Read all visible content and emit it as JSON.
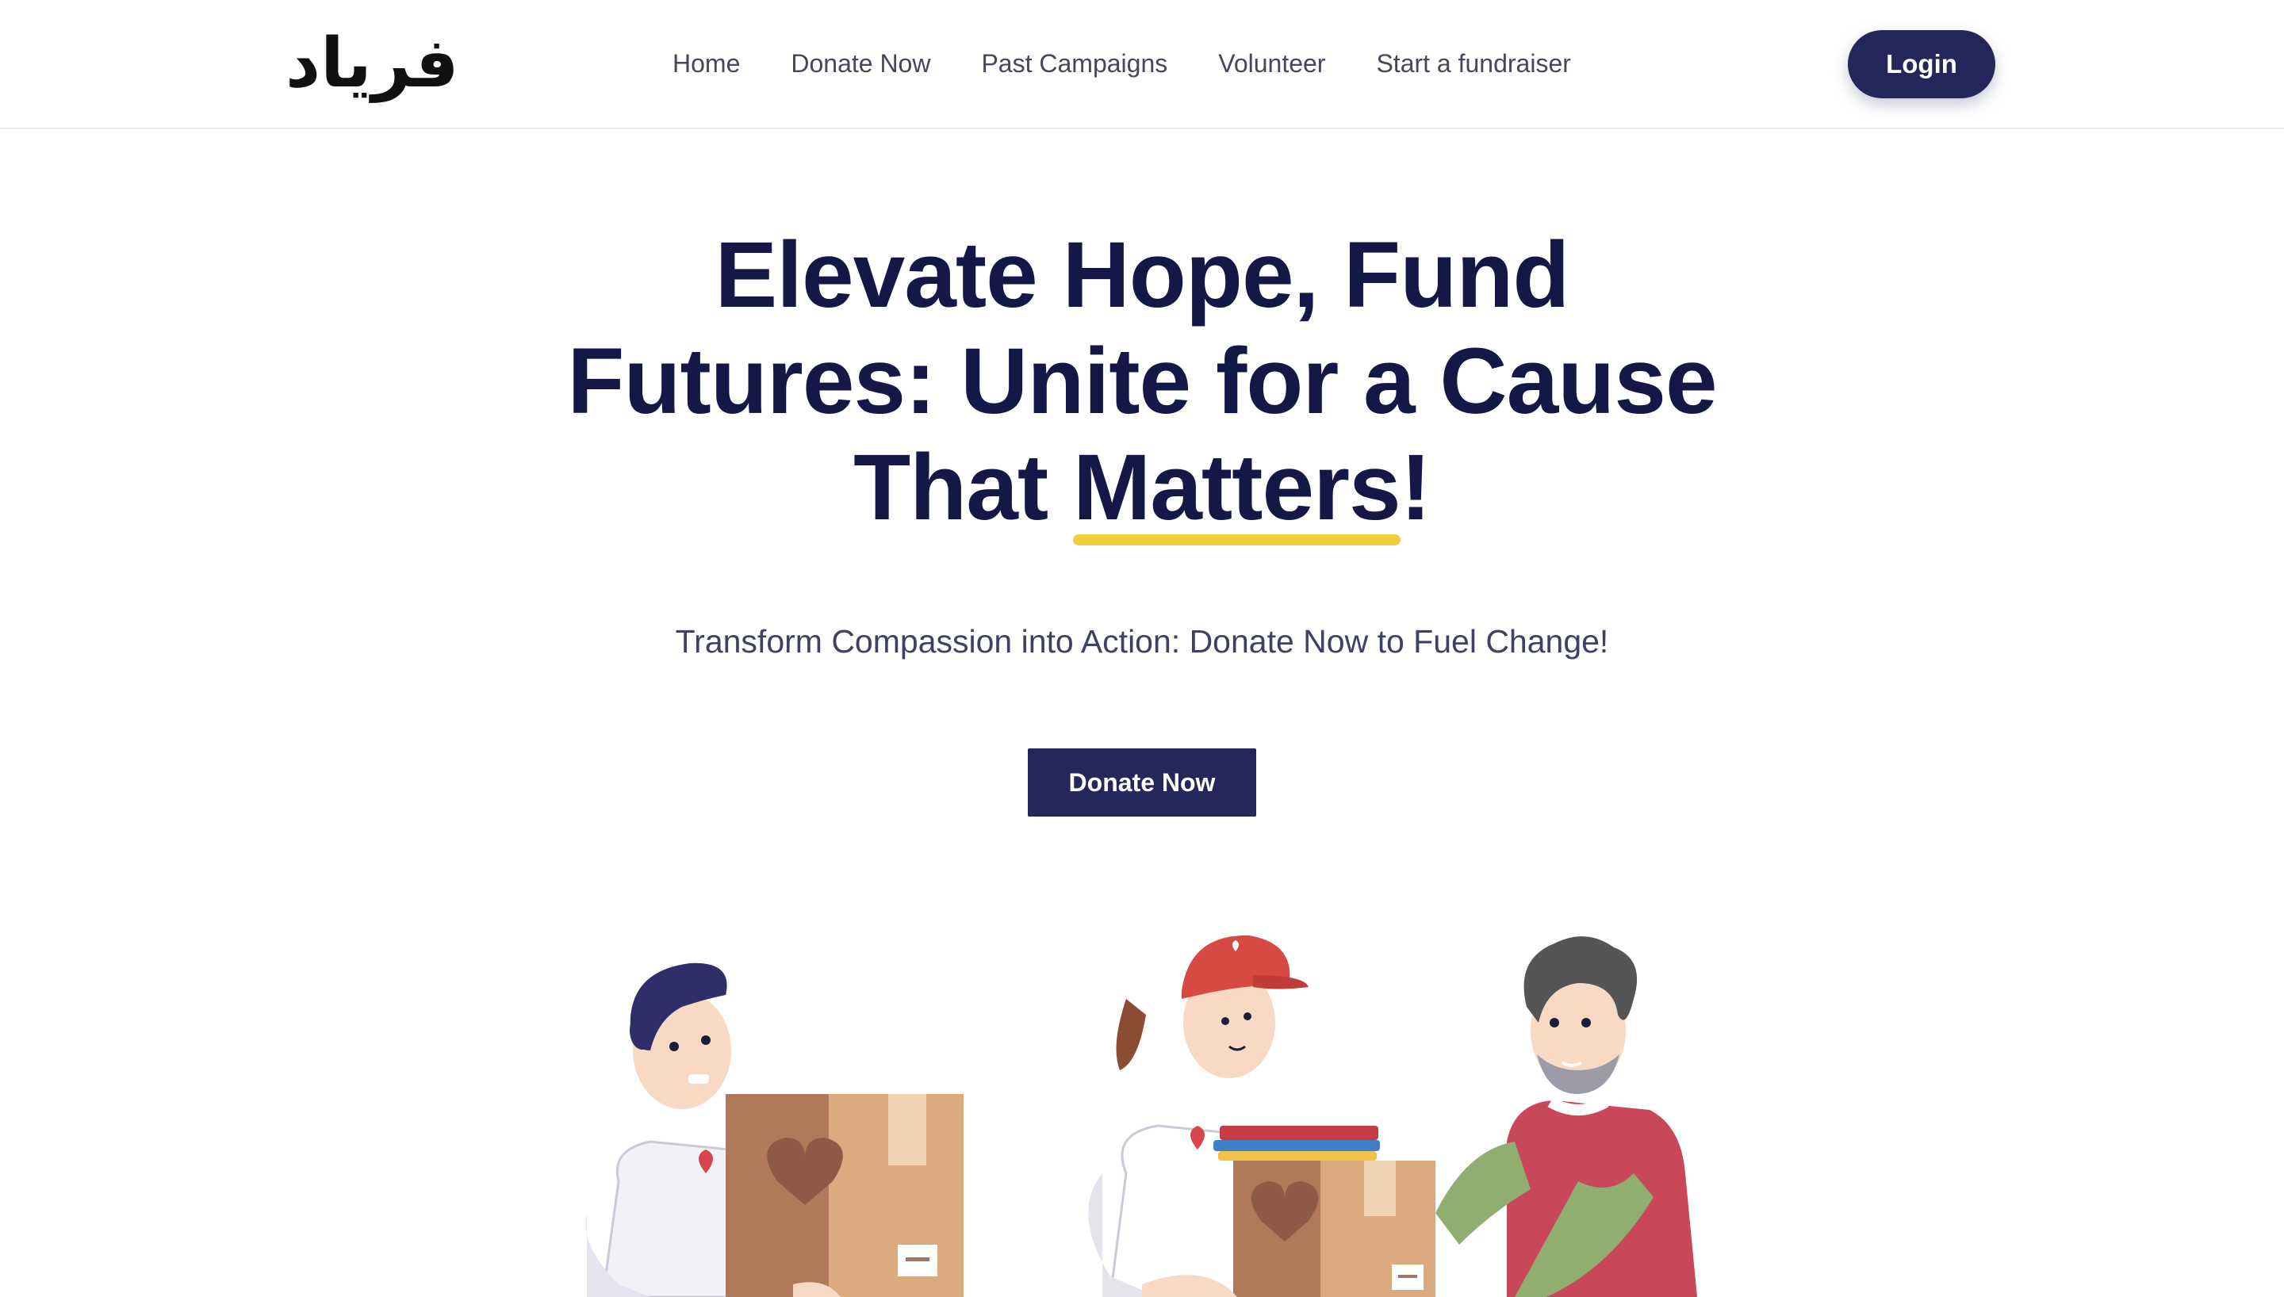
{
  "nav": {
    "logo_text": "فرياد",
    "links": [
      "Home",
      "Donate Now",
      "Past Campaigns",
      "Volunteer",
      "Start a fundraiser"
    ],
    "login_label": "Login"
  },
  "hero": {
    "title_line1": "Elevate Hope, Fund",
    "title_line2": "Futures: Unite for a Cause",
    "title_line3_prefix": "That ",
    "title_line3_highlight": "Matters",
    "title_line3_suffix": "!",
    "subtitle": "Transform Compassion into Action: Donate Now to Fuel Change!",
    "cta_label": "Donate Now"
  },
  "colors": {
    "primary": "#23275a",
    "heading": "#141846",
    "highlight": "#f1cf3c",
    "box": "#d9ab7e",
    "shirt_red": "#c8485a",
    "sleeve_green": "#8fae70"
  },
  "illustration": {
    "figures": [
      "volunteer-carrying-box",
      "volunteer-with-cap-handing-box",
      "bearded-man-receiving-box"
    ]
  }
}
